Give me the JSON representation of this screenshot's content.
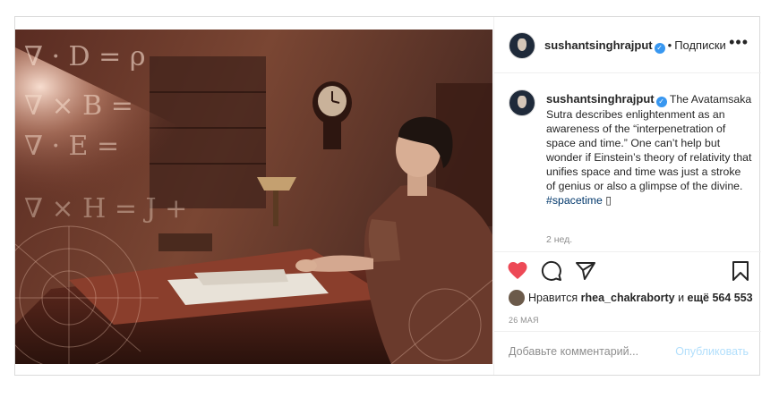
{
  "post": {
    "header": {
      "username": "sushantsinghrajput",
      "separator": "•",
      "follow_label": "Подписки",
      "more_label": "•••"
    },
    "caption": {
      "username": "sushantsinghrajput",
      "text": "The Avatamsaka Sutra describes enlightenment as an awareness of the “interpenetration of space and time.” One can’t help but wonder if Einstein’s theory of relativity that unifies space and time was just a stroke of genius or also a glimpse of the divine.",
      "hashtag": "#spacetime",
      "emoji": "▯",
      "time": "2 нед."
    },
    "likes": {
      "prefix": "Нравится",
      "user": "rhea_chakraborty",
      "middle": "и",
      "count_text": "ещё 564 553"
    },
    "date": "26 МАЯ",
    "comment_box": {
      "placeholder": "Добавьте комментарий...",
      "publish_label": "Опубликовать"
    },
    "colors": {
      "like_heart": "#ed4956",
      "hashtag": "#00376b",
      "publish_disabled": "#b2dffc",
      "verified": "#3897f0"
    },
    "icons": [
      "heart-icon",
      "comment-icon",
      "share-icon",
      "bookmark-icon",
      "verified-icon"
    ]
  }
}
